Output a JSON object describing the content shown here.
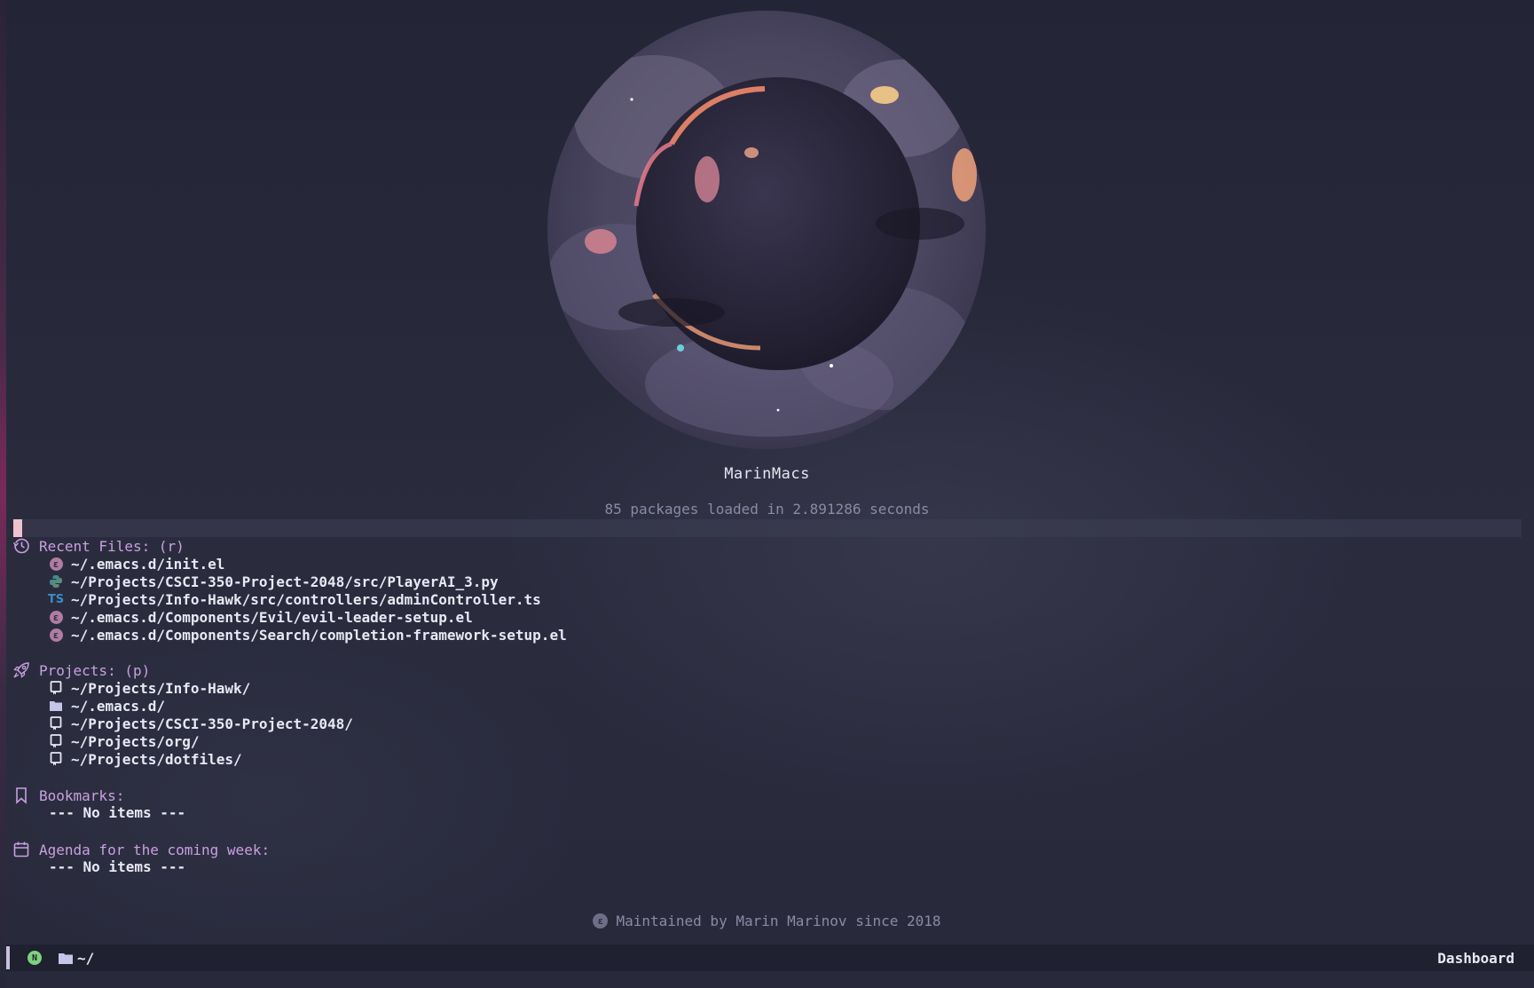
{
  "banner": {
    "title": "MarinMacs",
    "subtitle": "85 packages loaded in 2.891286 seconds"
  },
  "recent_files": {
    "heading": "Recent Files: (r)",
    "icon": "history-icon",
    "items": [
      {
        "icon": "emacs-icon",
        "path": "~/.emacs.d/init.el"
      },
      {
        "icon": "python-icon",
        "path": "~/Projects/CSCI-350-Project-2048/src/PlayerAI_3.py"
      },
      {
        "icon": "typescript-icon",
        "badge": "TS",
        "path": "~/Projects/Info-Hawk/src/controllers/adminController.ts"
      },
      {
        "icon": "emacs-icon",
        "path": "~/.emacs.d/Components/Evil/evil-leader-setup.el"
      },
      {
        "icon": "emacs-icon",
        "path": "~/.emacs.d/Components/Search/completion-framework-setup.el"
      }
    ]
  },
  "projects": {
    "heading": "Projects: (p)",
    "icon": "rocket-icon",
    "items": [
      {
        "icon": "repo-icon",
        "path": "~/Projects/Info-Hawk/"
      },
      {
        "icon": "folder-icon",
        "path": "~/.emacs.d/"
      },
      {
        "icon": "repo-icon",
        "path": "~/Projects/CSCI-350-Project-2048/"
      },
      {
        "icon": "repo-icon",
        "path": "~/Projects/org/"
      },
      {
        "icon": "repo-icon",
        "path": "~/Projects/dotfiles/"
      }
    ]
  },
  "bookmarks": {
    "heading": "Bookmarks:",
    "icon": "bookmark-icon",
    "empty": "--- No items ---"
  },
  "agenda": {
    "heading": "Agenda for the coming week:",
    "icon": "calendar-icon",
    "empty": "--- No items ---"
  },
  "footer": {
    "text": "Maintained by Marin Marinov since 2018",
    "icon": "emacs-icon"
  },
  "modeline": {
    "state": "N",
    "directory": "~/",
    "buffer": "Dashboard"
  },
  "colors": {
    "background": "#262838",
    "heading": "#c8a0e0",
    "text": "#e8e8f4",
    "muted": "#8a8aa4",
    "emacs_icon": "#b07ca2",
    "ts_icon": "#3a8cc8",
    "state_normal": "#7ed27e",
    "cursor": "#f0c2cf"
  }
}
